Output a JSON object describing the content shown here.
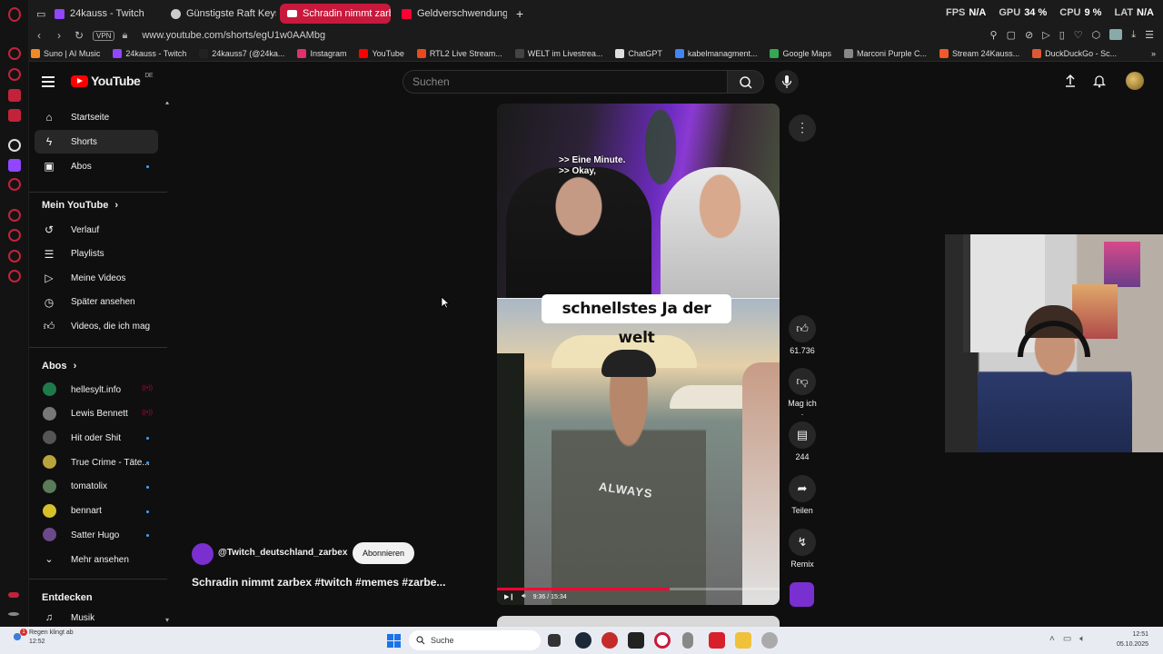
{
  "browser": {
    "tabs": [
      {
        "label": "24kauss - Twitch",
        "color": "#9146ff"
      },
      {
        "label": "Günstigste Raft Keys",
        "color": "#cccccc"
      },
      {
        "label": "Schradin nimmt zarbe",
        "color": "#ff0033",
        "active": true
      },
      {
        "label": "Geldverschwendung und",
        "color": "#ff0033"
      }
    ],
    "new_tab_label": "+",
    "stats": [
      {
        "label": "FPS",
        "value": "N/A"
      },
      {
        "label": "GPU",
        "value": "34 %"
      },
      {
        "label": "CPU",
        "value": "9 %"
      },
      {
        "label": "LAT",
        "value": "N/A"
      }
    ],
    "url": "www.youtube.com/shorts/egU1w0AAMbg",
    "vpn_label": "VPN",
    "bookmarks": [
      {
        "label": "Suno | AI Music",
        "color": "#f08a24"
      },
      {
        "label": "24kauss - Twitch",
        "color": "#9146ff"
      },
      {
        "label": "24kauss7 (@24ka...",
        "color": "#222222"
      },
      {
        "label": "Instagram",
        "color": "#e1306c"
      },
      {
        "label": "YouTube",
        "color": "#ff0000"
      },
      {
        "label": "RTL2 Live Stream...",
        "color": "#e84a1e"
      },
      {
        "label": "WELT im Livestrea...",
        "color": "#444444"
      },
      {
        "label": "ChatGPT",
        "color": "#dddddd"
      },
      {
        "label": "kabelmanagment...",
        "color": "#4285f4"
      },
      {
        "label": "Google Maps",
        "color": "#34a853"
      },
      {
        "label": "Marconi Purple C...",
        "color": "#888888"
      },
      {
        "label": "Stream 24Kauss...",
        "color": "#f05a28"
      },
      {
        "label": "DuckDuckGo - Sc...",
        "color": "#de5833"
      }
    ]
  },
  "youtube": {
    "logo_text": "YouTube",
    "logo_region": "DE",
    "search_placeholder": "Suchen",
    "sidebar": {
      "main": [
        {
          "label": "Startseite",
          "icon": "home-icon"
        },
        {
          "label": "Shorts",
          "icon": "shorts-icon",
          "active": true
        },
        {
          "label": "Abos",
          "icon": "subscriptions-icon",
          "dot": true
        }
      ],
      "you_heading": "Mein YouTube",
      "you": [
        {
          "label": "Verlauf",
          "icon": "history-icon"
        },
        {
          "label": "Playlists",
          "icon": "playlist-icon"
        },
        {
          "label": "Meine Videos",
          "icon": "my-videos-icon"
        },
        {
          "label": "Später ansehen",
          "icon": "watch-later-icon"
        },
        {
          "label": "Videos, die ich mag",
          "icon": "like-icon"
        }
      ],
      "subs_heading": "Abos",
      "subs": [
        {
          "label": "hellesylt.info",
          "color": "#1f7a4a",
          "live": true
        },
        {
          "label": "Lewis Bennett",
          "color": "#777777",
          "live": true
        },
        {
          "label": "Hit oder Shit",
          "color": "#555555",
          "dot": true
        },
        {
          "label": "True Crime - Täte...",
          "color": "#b8a43a",
          "dot": true
        },
        {
          "label": "tomatolix",
          "color": "#5a7a5a",
          "dot": true
        },
        {
          "label": "bennart",
          "color": "#d8c02a",
          "dot": true
        },
        {
          "label": "Satter Hugo",
          "color": "#6a4a8a",
          "dot": true
        }
      ],
      "show_more": "Mehr ansehen",
      "explore_heading": "Entdecken",
      "explore": [
        {
          "label": "Musik",
          "icon": "music-icon"
        }
      ]
    },
    "short": {
      "subtitle_line1": ">> Eine Minute.",
      "subtitle_line2": ">> Okay,",
      "caption": "schnellstes Ja der welt",
      "shirt_text": "ALWAYS",
      "time": "9:36 / 15:34",
      "progress": 0.61,
      "channel": "@Twitch_deutschland_zarbex",
      "subscribe": "Abonnieren",
      "title": "Schradin nimmt zarbex #twitch #memes #zarbe...",
      "actions": [
        {
          "label": "61.736",
          "icon": "thumbs-up-icon"
        },
        {
          "label": "Mag ich .",
          "icon": "thumbs-down-icon"
        },
        {
          "label": "244",
          "icon": "comment-icon"
        },
        {
          "label": "Teilen",
          "icon": "share-icon"
        },
        {
          "label": "Remix",
          "icon": "remix-icon"
        }
      ]
    }
  },
  "taskbar": {
    "weather_line1": "Regen klingt ab",
    "weather_line2": "12:52",
    "notification_count": "1",
    "search_label": "Suche",
    "time": "12:51",
    "date": "05.10.2025"
  }
}
